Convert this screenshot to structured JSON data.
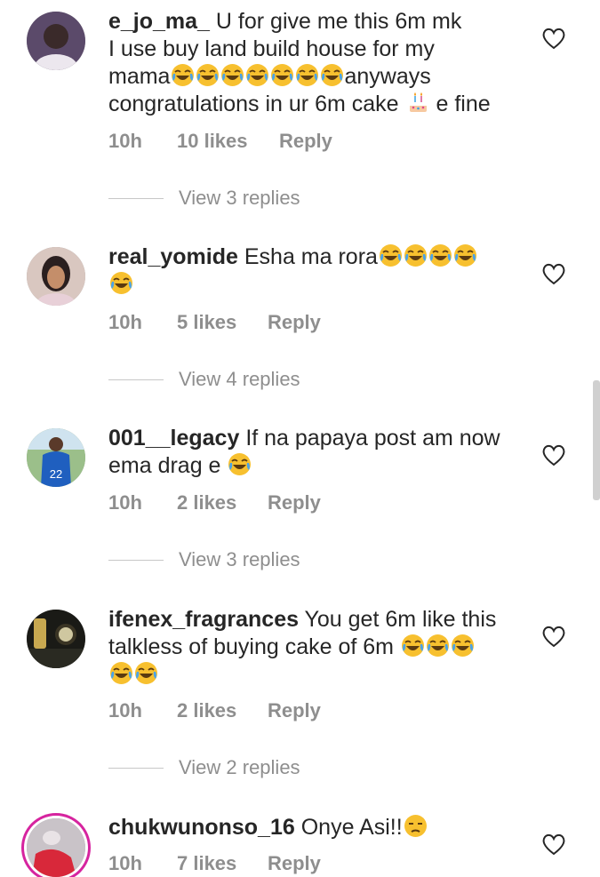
{
  "comments": [
    {
      "username": "e_jo_ma_",
      "text_lines": [
        "U for give me this 6m mk",
        "I use buy land build house for my",
        "mama",
        "anyways",
        "congratulations in ur 6m cake",
        "e fine"
      ],
      "time": "10h",
      "likes": "10 likes",
      "reply": "Reply",
      "view_replies": "View 3 replies"
    },
    {
      "username": "real_yomide",
      "text": "Esha ma rora",
      "time": "10h",
      "likes": "5 likes",
      "reply": "Reply",
      "view_replies": "View 4 replies"
    },
    {
      "username": "001__legacy",
      "text_line1": "If na papaya post am now",
      "text_line2": "ema drag e",
      "time": "10h",
      "likes": "2 likes",
      "reply": "Reply",
      "view_replies": "View 3 replies"
    },
    {
      "username": "ifenex_fragrances",
      "text_line1": "You get 6m like this",
      "text_line2": "talkless of buying cake of 6m",
      "time": "10h",
      "likes": "2 likes",
      "reply": "Reply",
      "view_replies": "View 2 replies"
    },
    {
      "username": "chukwunonso_16",
      "text": "Onye Asi!!",
      "time": "10h",
      "likes": "7 likes",
      "reply": "Reply"
    }
  ],
  "icons": {
    "like": "heart-outline-icon",
    "laugh": "face-with-tears-of-joy-emoji",
    "cake": "birthday-cake-emoji",
    "unamused": "unamused-face-emoji"
  },
  "colors": {
    "text": "#262626",
    "meta": "#8e8e8e",
    "emoji": "#f7c02f",
    "story_ring": "#d6249f"
  }
}
